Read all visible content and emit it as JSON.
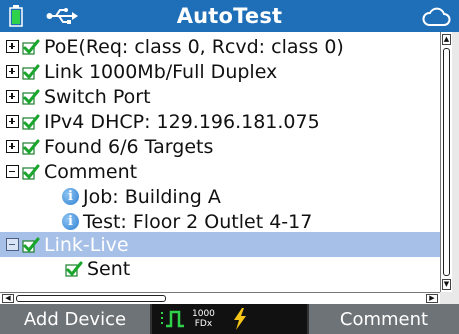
{
  "header": {
    "title": "AutoTest",
    "icons": [
      "battery-icon",
      "usb-icon",
      "cloud-icon"
    ]
  },
  "tree": {
    "items": [
      {
        "label": "PoE(Req: class 0, Rcvd: class 0)",
        "expander": "plus",
        "icon": "check"
      },
      {
        "label": "Link 1000Mb/Full Duplex",
        "expander": "plus",
        "icon": "check"
      },
      {
        "label": "Switch Port",
        "expander": "plus",
        "icon": "check"
      },
      {
        "label": "IPv4 DHCP: 129.196.181.075",
        "expander": "plus",
        "icon": "check"
      },
      {
        "label": "Found 6/6 Targets",
        "expander": "plus",
        "icon": "check"
      },
      {
        "label": "Comment",
        "expander": "minus",
        "icon": "check"
      },
      {
        "label": "Job: Building A",
        "icon": "info"
      },
      {
        "label": "Test: Floor 2 Outlet 4-17",
        "icon": "info"
      },
      {
        "label": "Link-Live",
        "expander": "minus",
        "icon": "check",
        "selected": true
      },
      {
        "label": "Sent",
        "icon": "check"
      }
    ]
  },
  "status": {
    "link_speed_value": "1000",
    "link_speed_unit": "FDx"
  },
  "softkeys": {
    "left_label": "Add Device",
    "right_label": "Comment"
  },
  "colors": {
    "title_bar": "#1f6fb8",
    "selection": "#a7c0e8",
    "check_green": "#1aa52c",
    "softkey_bar": "#6e7377",
    "bolt": "#f5c518"
  }
}
